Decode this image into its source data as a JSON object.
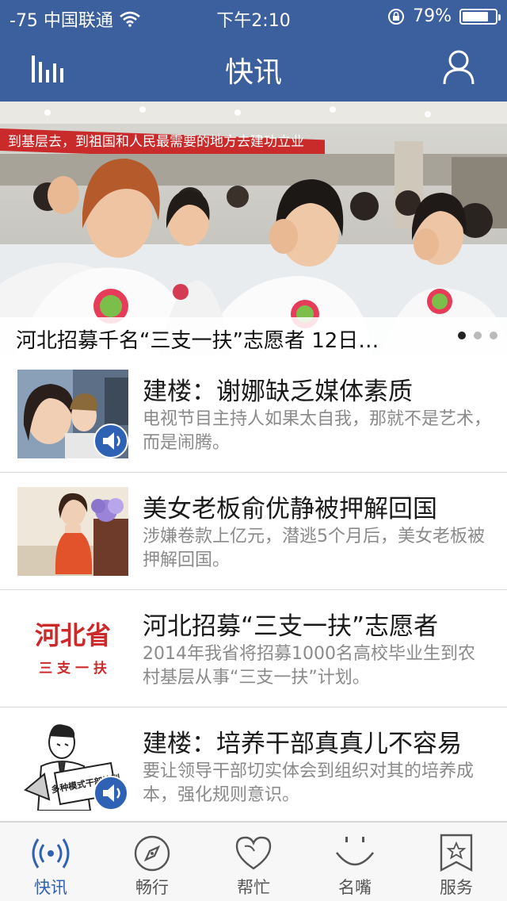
{
  "status_bar": {
    "carrier": "-75 中国联通",
    "time": "下午2:10",
    "battery": "79%",
    "battery_level": 0.79,
    "icons": [
      "wifi-icon",
      "rotation-lock-icon",
      "battery-icon"
    ]
  },
  "nav": {
    "title": "快讯",
    "left_icon": "equalizer-icon",
    "right_icon": "user-icon"
  },
  "banner": {
    "caption": "河北招募千名“三支一扶”志愿者 12日…",
    "photo_banner_text": "到基层去，到祖国和人民最需要的地方去建功立业",
    "page_count": 3,
    "active_page": 1
  },
  "news": [
    {
      "title": "建楼：谢娜缺乏媒体素质",
      "summary": "电视节目主持人如果太自我，那就不是艺术，而是闹腾。",
      "has_audio": true,
      "thumb_text": ""
    },
    {
      "title": "美女老板俞优静被押解回国",
      "summary": "涉嫌卷款上亿元，潜逃5个月后，美女老板被押解回国。",
      "has_audio": false,
      "thumb_text": ""
    },
    {
      "title": "河北招募“三支一扶”志愿者",
      "summary": "2014年我省将招募1000名高校毕业生到农村基层从事“三支一扶”计划。",
      "has_audio": false,
      "thumb_text": "河北省",
      "thumb_subtext": "三 支 一 扶"
    },
    {
      "title": "建楼：培养干部真真儿不容易",
      "summary": "要让领导干部切实体会到组织对其的培养成本，强化规则意识。",
      "has_audio": true,
      "thumb_text": "多种模式干部培训"
    }
  ],
  "tabs": [
    {
      "label": "快讯",
      "icon": "broadcast-icon",
      "active": true
    },
    {
      "label": "畅行",
      "icon": "compass-icon",
      "active": false
    },
    {
      "label": "帮忙",
      "icon": "heart-icon",
      "active": false
    },
    {
      "label": "名嘴",
      "icon": "smile-icon",
      "active": false
    },
    {
      "label": "服务",
      "icon": "star-bookmark-icon",
      "active": false
    }
  ],
  "colors": {
    "bar_blue": "#3c5f9d",
    "accent_blue": "#2f62b4",
    "summary_gray": "#8a8a8a"
  }
}
